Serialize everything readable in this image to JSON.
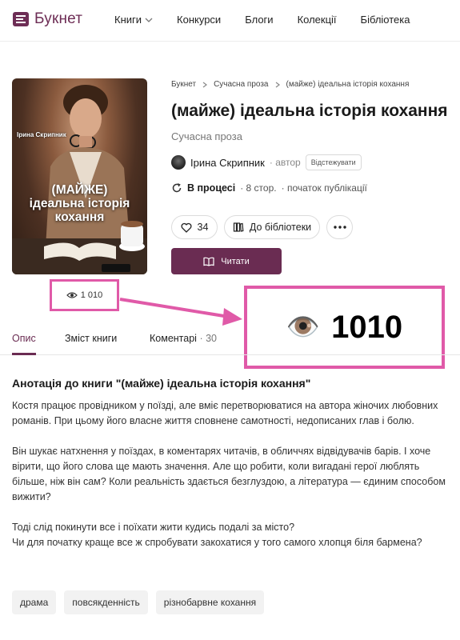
{
  "header": {
    "logo_text": "Букнет",
    "nav": [
      {
        "label": "Книги",
        "has_dropdown": true
      },
      {
        "label": "Конкурси"
      },
      {
        "label": "Блоги"
      },
      {
        "label": "Колекції"
      },
      {
        "label": "Бібліотека"
      }
    ]
  },
  "colors": {
    "brand": "#6a2c52",
    "highlight": "#e05aa8"
  },
  "cover": {
    "author": "Ірина Скрипник",
    "title_line1": "(МАЙЖЕ)",
    "title_line2": "ідеальна історія",
    "title_line3": "кохання"
  },
  "views": {
    "small": "1 010",
    "big": "1010",
    "big_icon": "👁️"
  },
  "breadcrumb": [
    "Букнет",
    "Сучасна проза",
    "(майже) ідеальна історія кохання"
  ],
  "book": {
    "title": "(майже) ідеальна історія кохання",
    "genre": "Сучасна проза",
    "author_name": "Ірина Скрипник",
    "author_role": "· автор",
    "follow_label": "Відстежувати",
    "status": "В процесі",
    "pages": "· 8 стор.",
    "publication": "· початок публікації",
    "likes": "34",
    "library_label": "До бібліотеки",
    "read_label": "Читати"
  },
  "tabs": [
    {
      "label": "Опис",
      "active": true
    },
    {
      "label": "Зміст книги"
    },
    {
      "label": "Коментарі",
      "count": "· 30"
    }
  ],
  "annotation": {
    "title": "Анотація до книги \"(майже) ідеальна історія кохання\"",
    "paragraphs": [
      "Костя працює провідником у поїзді, але вміє перетворюватися на автора жіночих любовних романів. При цьому його власне життя сповнене самотності, недописаних глав і болю.",
      "Він шукає натхнення у поїздах, в коментарях читачів, в обличчях відвідувачів барів. І хоче вірити, що його слова ще мають значення. Але що робити, коли вигадані герої люблять більше, ніж він сам? Коли реальність здається безглуздою, а література — єдиним способом вижити?",
      "Тоді слід покинути все і поїхати жити кудись подалі за місто?",
      "Чи для початку краще все ж спробувати закохатися у того самого хлопця біля бармена?"
    ]
  },
  "tags": [
    "драма",
    "повсякденність",
    "різнобарвне кохання"
  ]
}
